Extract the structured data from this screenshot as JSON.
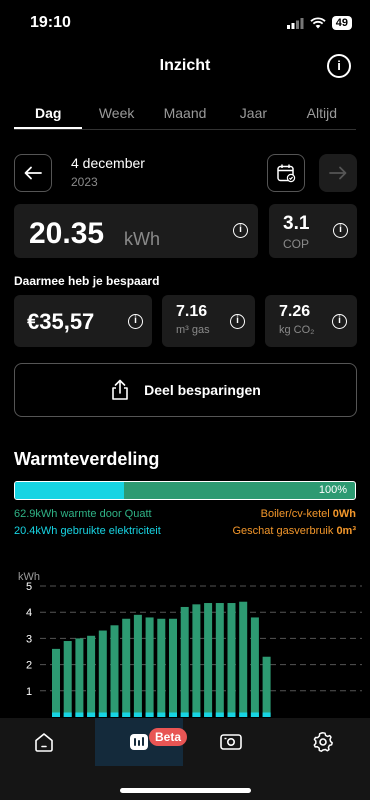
{
  "status": {
    "time": "19:10",
    "battery": "49"
  },
  "header": {
    "title": "Inzicht",
    "info_icon": "info-icon"
  },
  "tabs": [
    {
      "label": "Dag",
      "active": true
    },
    {
      "label": "Week",
      "active": false
    },
    {
      "label": "Maand",
      "active": false
    },
    {
      "label": "Jaar",
      "active": false
    },
    {
      "label": "Altijd",
      "active": false
    }
  ],
  "date": {
    "title": "4 december",
    "year": "2023"
  },
  "energy": {
    "value": "20.35",
    "unit": "kWh"
  },
  "cop": {
    "value": "3.1",
    "label": "COP"
  },
  "savings": {
    "heading": "Daarmee heb je bespaard",
    "euro": "€35,57",
    "gas_value": "7.16",
    "gas_unit": "m³ gas",
    "co2_value": "7.26",
    "co2_unit": "kg CO₂"
  },
  "share": {
    "label": "Deel besparingen"
  },
  "distribution": {
    "title": "Warmteverdeling",
    "bar_percent": 100,
    "bar_label": "100%",
    "cyan_fraction": 0.32,
    "left1_value": "62.9kWh",
    "left1_text": "warmte door Quatt",
    "left2_value": "20.4kWh",
    "left2_text": "gebruikte elektriciteit",
    "right1_text": "Boiler/cv-ketel",
    "right1_value": "0Wh",
    "right2_text": "Geschat gasverbruik",
    "right2_value": "0m³",
    "colors": {
      "green": "#2d9a72",
      "cyan": "#17d4e3",
      "orange": "#f3972b"
    }
  },
  "chart_data": {
    "type": "bar",
    "ylabel": "kWh",
    "ylim": [
      0,
      5.5
    ],
    "yticks": [
      "1",
      "2",
      "3",
      "4",
      "5"
    ],
    "series": [
      {
        "name": "warmte",
        "values": [
          2.6,
          2.9,
          3.0,
          3.1,
          3.3,
          3.5,
          3.75,
          3.9,
          3.8,
          3.75,
          3.75,
          4.2,
          4.3,
          4.35,
          4.35,
          4.35,
          4.4,
          3.8,
          2.3
        ]
      },
      {
        "name": "elektriciteit",
        "values": [
          0.0,
          0.0,
          0.0,
          0.0,
          0.0,
          0.0,
          0.0,
          0.0,
          0.0,
          0.0,
          0.0,
          0.0,
          0.0,
          0.0,
          0.0,
          0.0,
          0.0,
          0.0,
          0.0
        ]
      }
    ]
  },
  "bottom_nav": {
    "items": [
      {
        "icon": "home-icon"
      },
      {
        "icon": "insights-icon",
        "badge": "Beta"
      },
      {
        "icon": "device-icon"
      },
      {
        "icon": "settings-icon"
      }
    ]
  }
}
